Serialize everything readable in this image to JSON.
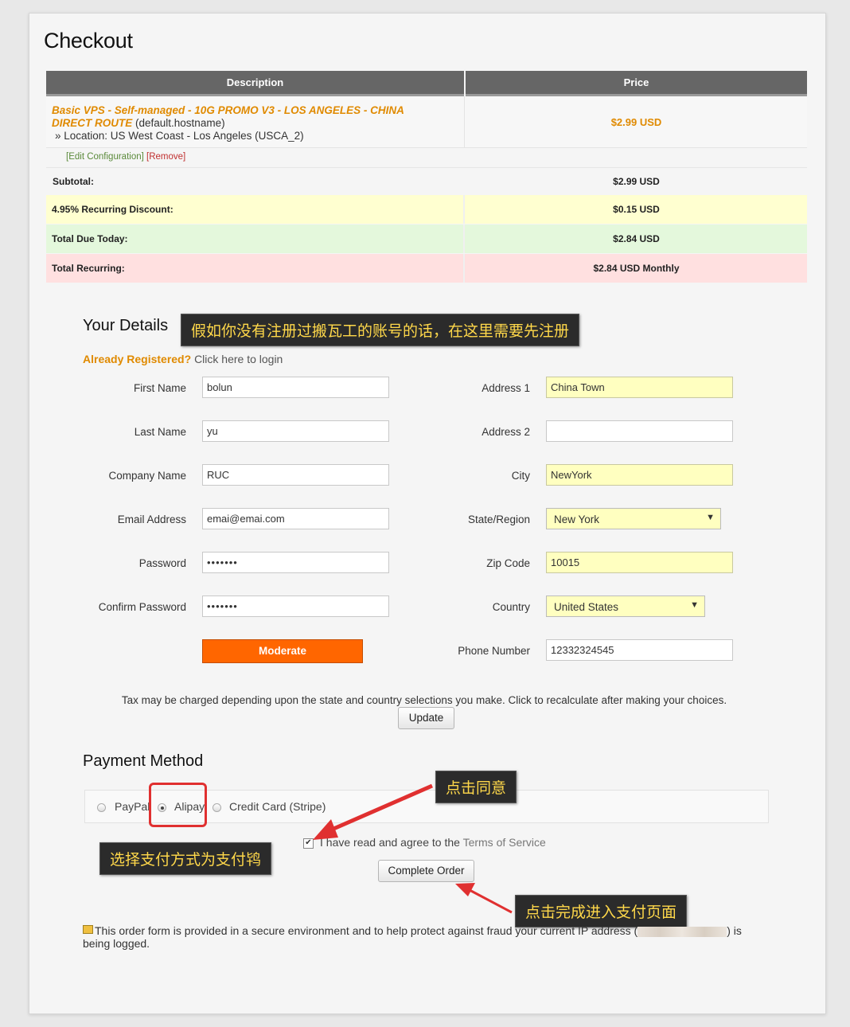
{
  "page_title": "Checkout",
  "cart": {
    "headers": [
      "Description",
      "Price"
    ],
    "product": {
      "name": "Basic VPS - Self-managed - 10G PROMO V3 - LOS ANGELES - CHINA DIRECT ROUTE",
      "hostname": "(default.hostname)",
      "location": "» Location: US West Coast - Los Angeles (USCA_2)",
      "edit_link": "[Edit Configuration]",
      "remove_link": "[Remove]",
      "price": "$2.99 USD"
    },
    "summary": [
      {
        "label": "Subtotal:",
        "value": "$2.99 USD",
        "color": "#f5f5f5"
      },
      {
        "label": "4.95% Recurring Discount:",
        "value": "$0.15 USD",
        "color": "#ffffd0"
      },
      {
        "label": "Total Due Today:",
        "value": "$2.84 USD",
        "color": "#e4f8dc"
      },
      {
        "label": "Total Recurring:",
        "value": "$2.84 USD Monthly",
        "color": "#ffe0e0"
      }
    ]
  },
  "details": {
    "title": "Your Details",
    "already_registered": "Already Registered?",
    "login_link": "Click here to login",
    "left_fields": [
      {
        "label": "First Name",
        "value": "bolun"
      },
      {
        "label": "Last Name",
        "value": "yu"
      },
      {
        "label": "Company Name",
        "value": "RUC"
      },
      {
        "label": "Email Address",
        "value": "emai@emai.com"
      },
      {
        "label": "Password",
        "value": "•••••••"
      },
      {
        "label": "Confirm Password",
        "value": "•••••••"
      }
    ],
    "password_strength": "Moderate",
    "right_fields": [
      {
        "label": "Address 1",
        "value": "China Town"
      },
      {
        "label": "Address 2",
        "value": ""
      },
      {
        "label": "City",
        "value": "NewYork"
      },
      {
        "label": "State/Region",
        "value": "New York"
      },
      {
        "label": "Zip Code",
        "value": "10015"
      },
      {
        "label": "Country",
        "value": "United States"
      },
      {
        "label": "Phone Number",
        "value": "12332324545"
      }
    ],
    "tax_note": "Tax may be charged depending upon the state and country selections you make. Click to recalculate after making your choices.",
    "update_button": "Update"
  },
  "payment": {
    "title": "Payment Method",
    "options": [
      "PayPal",
      "Alipay",
      "Credit Card (Stripe)"
    ],
    "selected": "Alipay",
    "agree_text": "I have read and agree to the",
    "terms_link": "Terms of Service",
    "complete_button": "Complete Order",
    "secure_note_1": "This order form is provided in a secure environment and to help protect against fraud your current IP address (",
    "secure_note_2": ") is",
    "secure_note_3": "being logged."
  },
  "annotations": {
    "register": "假如你没有注册过搬瓦工的账号的话，在这里需要先注册",
    "agree": "点击同意",
    "alipay": "选择支付方式为支付鸨",
    "complete": "点击完成进入支付页面"
  },
  "colors": {
    "accent_orange": "#e08a00",
    "strength_bar": "#ff6600",
    "annotation_bg": "#2b2b2b",
    "annotation_text": "#ffd84a",
    "highlight_red": "#e03030"
  }
}
